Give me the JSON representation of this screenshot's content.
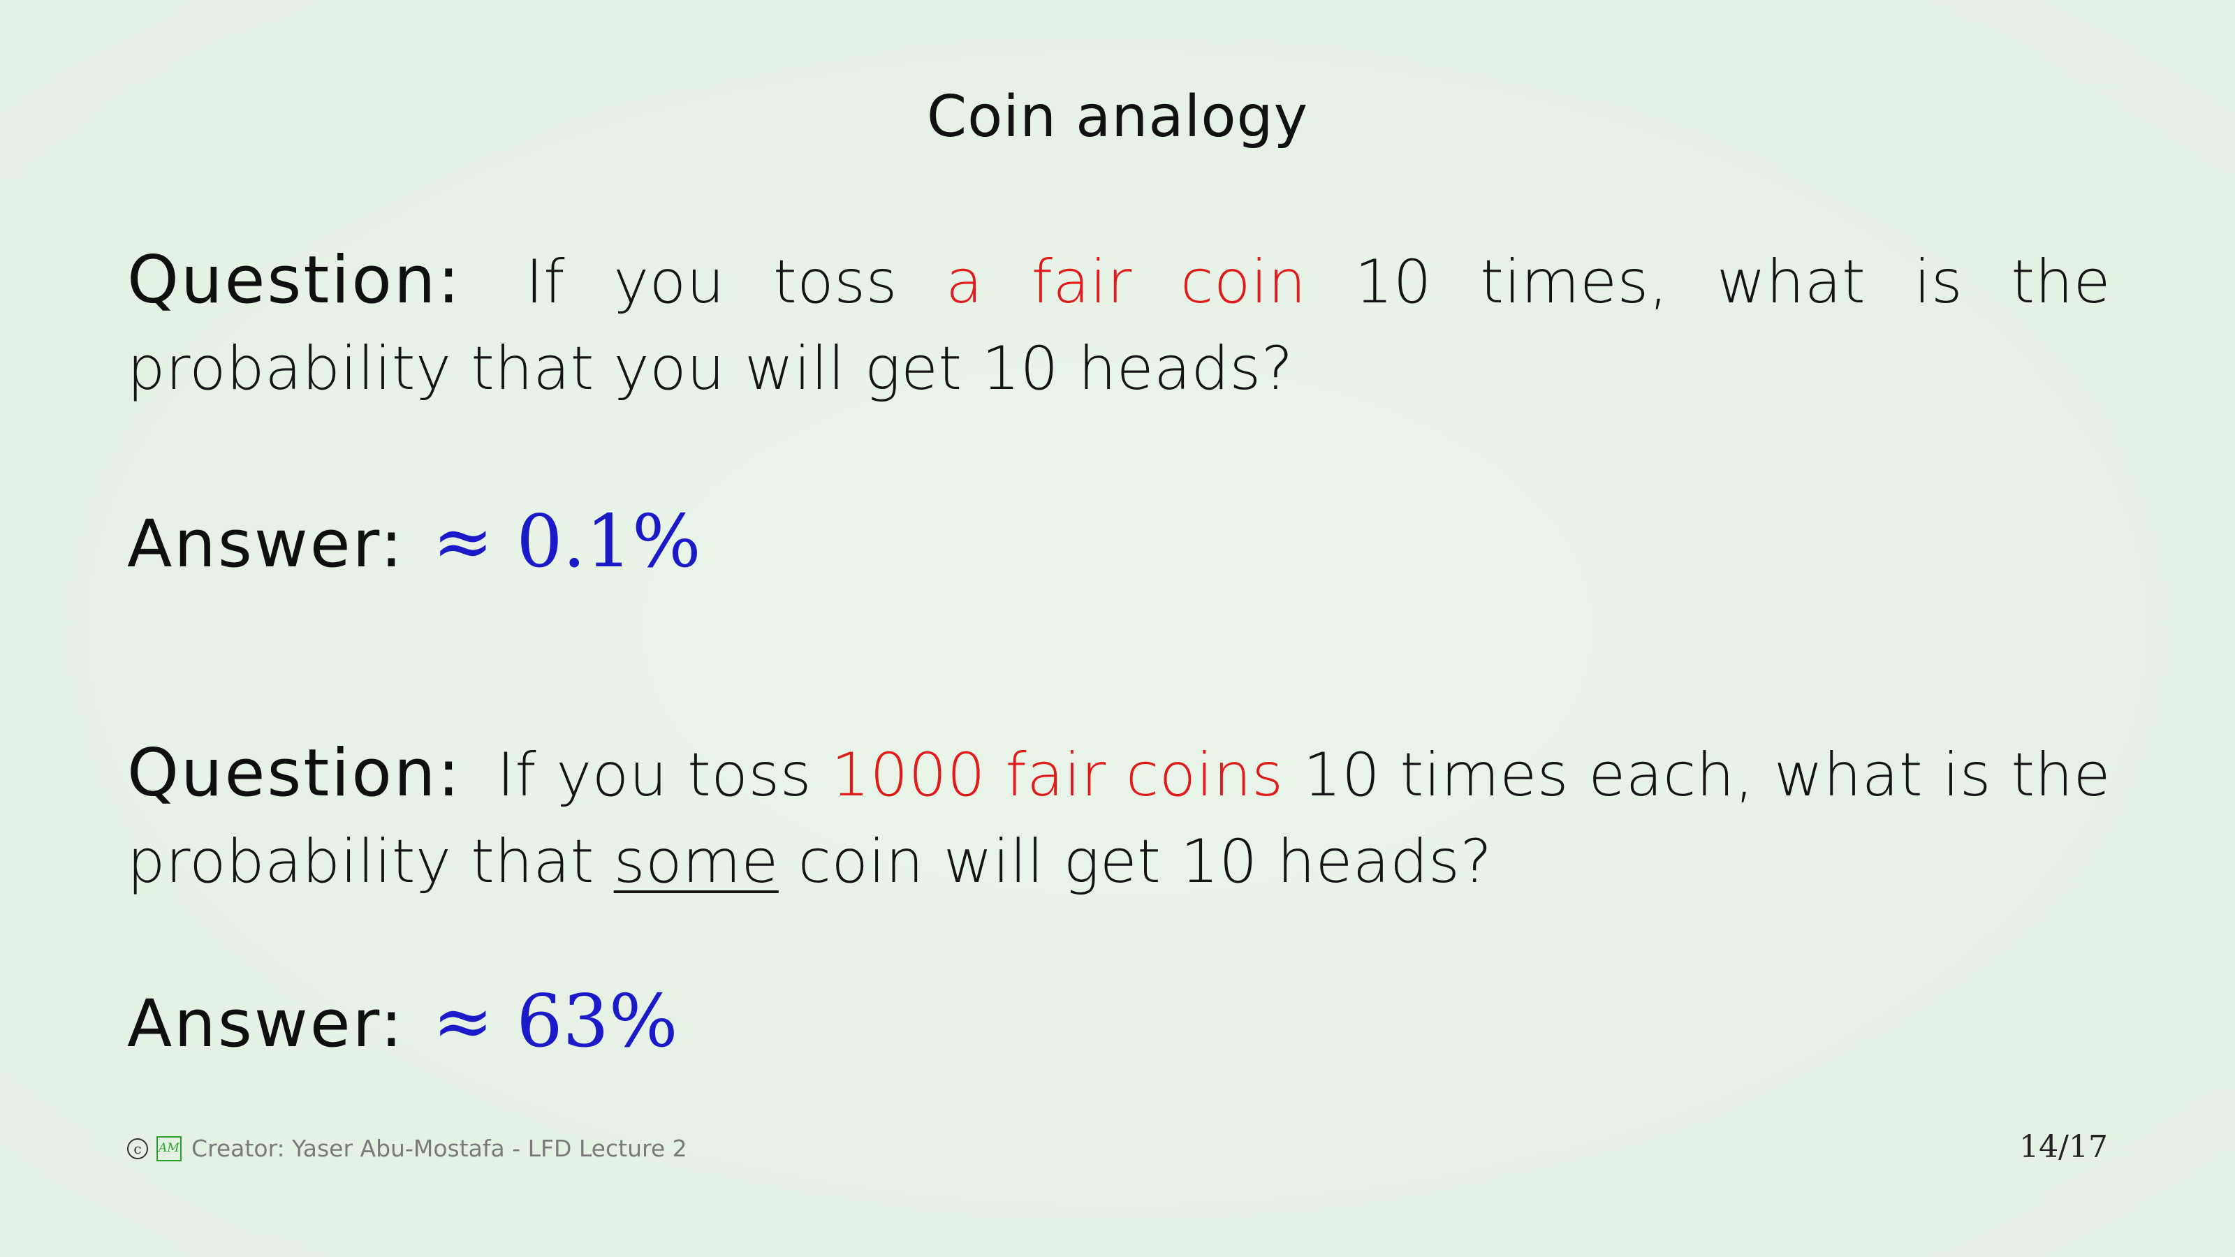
{
  "slide": {
    "title": "Coin analogy",
    "question1": {
      "label": "Question:",
      "before": "If you toss",
      "highlight": "a fair coin",
      "after": "10 times, what is the probability that you will get 10 heads?"
    },
    "answer1": {
      "label": "Answer:",
      "value": "≈ 0.1%"
    },
    "question2": {
      "label": "Question:",
      "before": "If you toss",
      "highlight": "1000 fair coins",
      "middle": "10 times each, what is the probability that",
      "underlined": "some",
      "after": "coin will get 10 heads?"
    },
    "answer2": {
      "label": "Answer:",
      "value": "≈ 63%"
    }
  },
  "footer": {
    "copyright_symbol": "c",
    "logo_text": "AM",
    "creator": "Creator: Yaser Abu-Mostafa - LFD Lecture 2",
    "page": "14/17"
  },
  "colors": {
    "background": "#e6f3e6",
    "highlight": "#e01b1b",
    "answer": "#1a1ac8",
    "logo": "#2aa02a"
  }
}
